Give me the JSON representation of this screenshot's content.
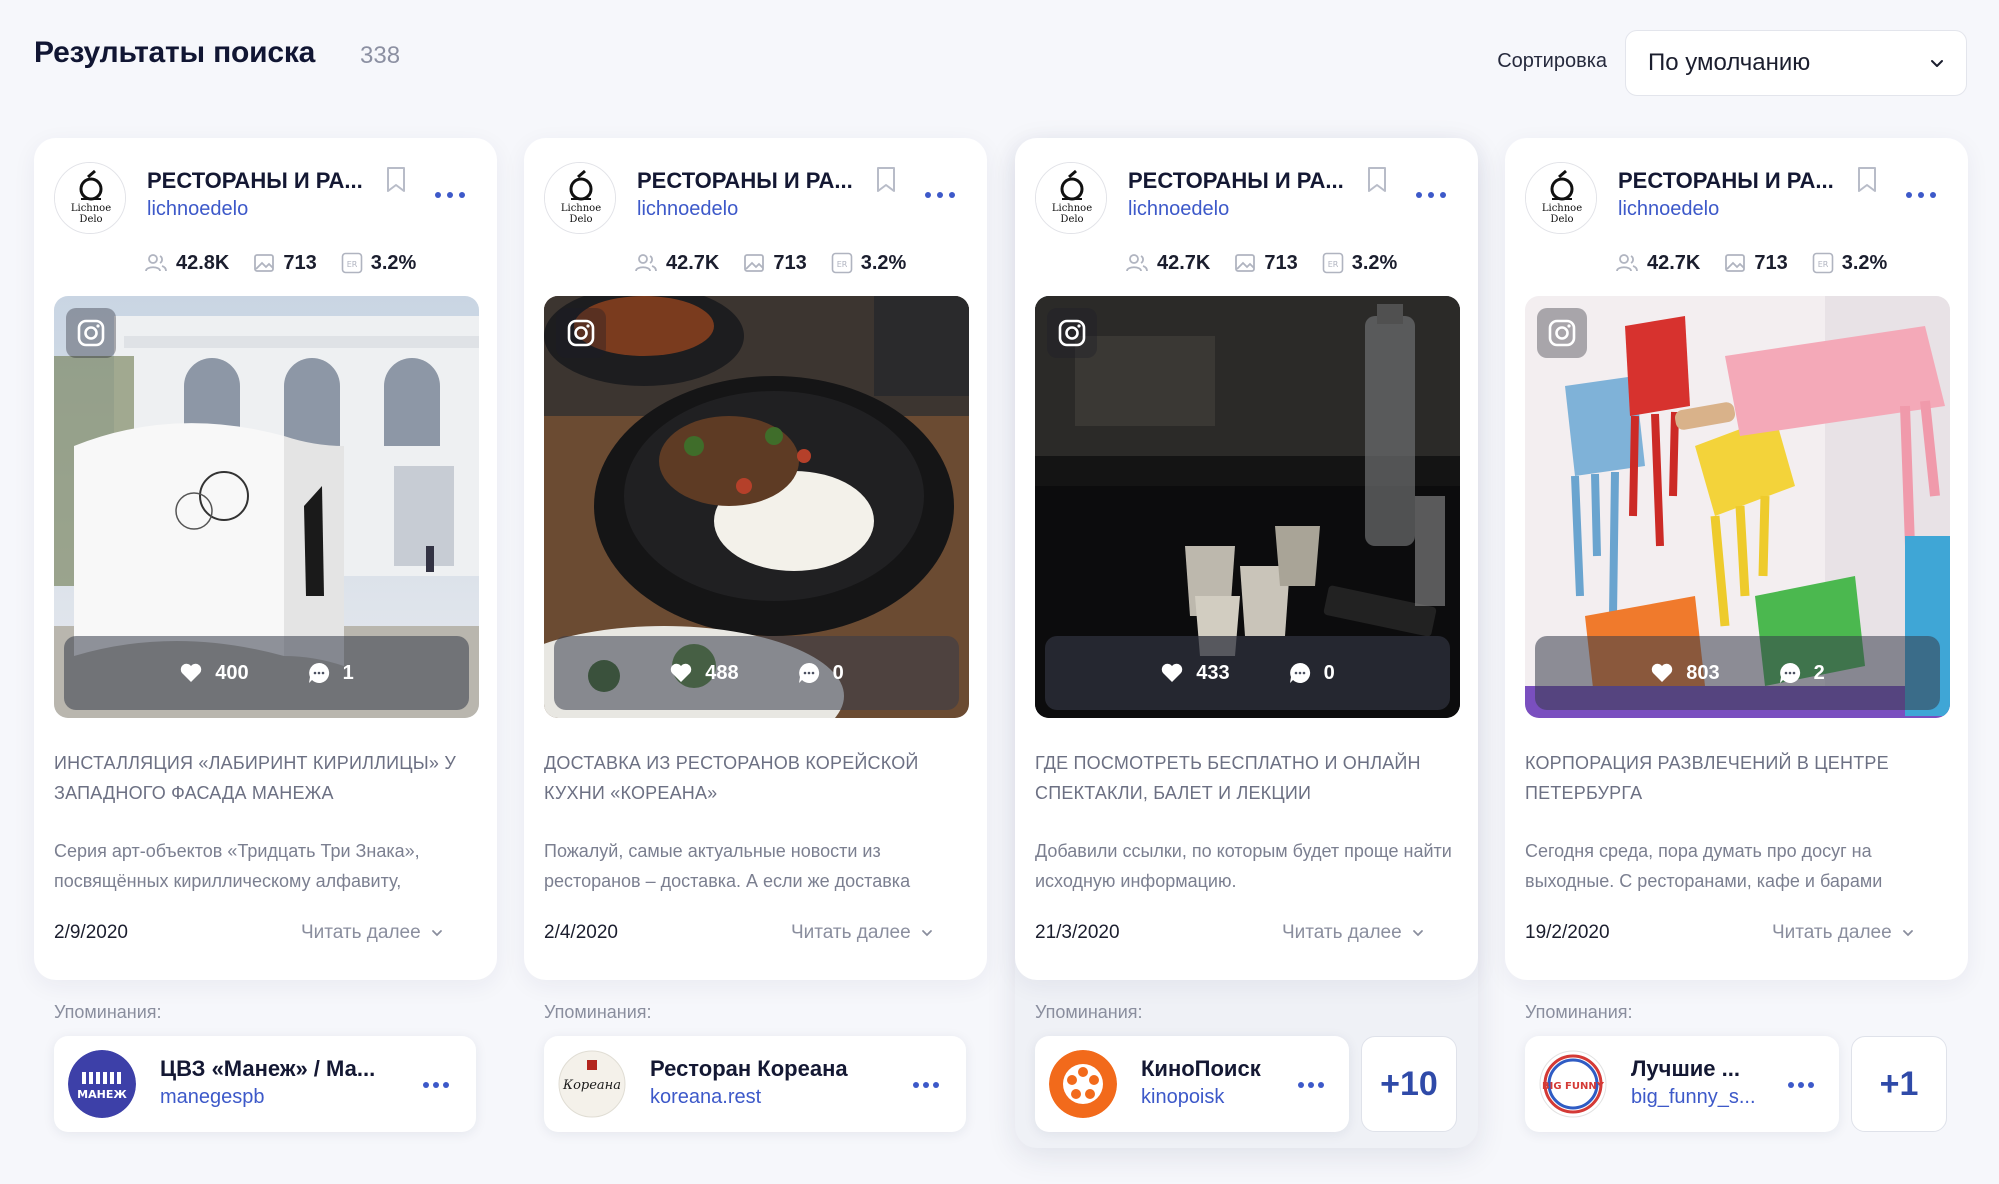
{
  "page": {
    "title": "Результаты поиска",
    "count": "338",
    "sort_label": "Сортировка",
    "sort_value": "По умолчанию"
  },
  "colors": {
    "accent": "#3d59c9",
    "text": "#1b1e2e",
    "muted": "#8a8e9e",
    "background": "#f6f7fb"
  },
  "avatar_text": {
    "line1": "Lichnoe",
    "line2": "Delo"
  },
  "cards": [
    {
      "account": {
        "name": "РЕСТОРАНЫ И РА...",
        "handle": "lichnoedelo"
      },
      "stats": {
        "followers": "42.8K",
        "posts": "713",
        "er": "3.2%"
      },
      "source_icon": "instagram-icon",
      "likes": "400",
      "comments": "1",
      "post_title": "ИНСТАЛЛЯЦИЯ «ЛАБИРИНТ КИРИЛЛИЦЫ» У ЗАПАДНОГО ФАСАДА МАНЕЖА",
      "post_text": "Серия арт-объектов «Тридцать Три Знака», посвящённых кириллическому алфавиту,",
      "date": "2/9/2020",
      "read_more": "Читать далее",
      "mentions_label": "Упоминания:",
      "mention": {
        "name": "ЦВЗ «Манеж» / Ма...",
        "handle": "manegespb",
        "logo_text": "МАНЕЖ"
      }
    },
    {
      "account": {
        "name": "РЕСТОРАНЫ И РА...",
        "handle": "lichnoedelo"
      },
      "stats": {
        "followers": "42.7K",
        "posts": "713",
        "er": "3.2%"
      },
      "source_icon": "instagram-icon",
      "likes": "488",
      "comments": "0",
      "post_title": "ДОСТАВКА ИЗ РЕСТОРАНОВ КОРЕЙСКОЙ КУХНИ «КОРЕАНА»",
      "post_text": "Пожалуй, самые актуальные новости из ресторанов – доставка. А если же доставка",
      "date": "2/4/2020",
      "read_more": "Читать далее",
      "mentions_label": "Упоминания:",
      "mention": {
        "name": "Ресторан Кореана",
        "handle": "koreana.rest",
        "logo_text": "Кореана"
      }
    },
    {
      "account": {
        "name": "РЕСТОРАНЫ И РА...",
        "handle": "lichnoedelo"
      },
      "stats": {
        "followers": "42.7K",
        "posts": "713",
        "er": "3.2%"
      },
      "source_icon": "instagram-icon",
      "likes": "433",
      "comments": "0",
      "post_title": "ГДЕ ПОСМОТРЕТЬ БЕСПЛАТНО И ОНЛАЙН СПЕКТАКЛИ, БАЛЕТ И ЛЕКЦИИ",
      "post_text": "Добавили ссылки, по которым будет проще найти исходную информацию.",
      "date": "21/3/2020",
      "read_more": "Читать далее",
      "mentions_label": "Упоминания:",
      "mention": {
        "name": "КиноПоиск",
        "handle": "kinopoisk",
        "more": "+10"
      }
    },
    {
      "account": {
        "name": "РЕСТОРАНЫ И РА...",
        "handle": "lichnoedelo"
      },
      "stats": {
        "followers": "42.7K",
        "posts": "713",
        "er": "3.2%"
      },
      "source_icon": "instagram-icon",
      "likes": "803",
      "comments": "2",
      "post_title": "КОРПОРАЦИЯ РАЗВЛЕЧЕНИЙ В ЦЕНТРЕ ПЕТЕРБУРГА",
      "post_text": "Сегодня среда, пора думать про досуг на выходные. С ресторанами, кафе и барами",
      "date": "19/2/2020",
      "read_more": "Читать далее",
      "mentions_label": "Упоминания:",
      "mention": {
        "name": "Лучшие ...",
        "handle": "big_funny_s...",
        "logo_text": "BIG FUNNY",
        "more": "+1"
      }
    }
  ]
}
